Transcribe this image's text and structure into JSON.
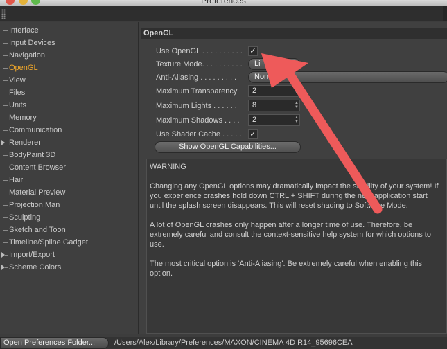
{
  "window": {
    "title": "Preferences"
  },
  "sidebar": {
    "items": [
      {
        "label": "Interface",
        "expandable": false
      },
      {
        "label": "Input Devices",
        "expandable": false
      },
      {
        "label": "Navigation",
        "expandable": false
      },
      {
        "label": "OpenGL",
        "expandable": false,
        "active": true
      },
      {
        "label": "View",
        "expandable": false
      },
      {
        "label": "Files",
        "expandable": false
      },
      {
        "label": "Units",
        "expandable": false
      },
      {
        "label": "Memory",
        "expandable": false
      },
      {
        "label": "Communication",
        "expandable": false
      },
      {
        "label": "Renderer",
        "expandable": true
      },
      {
        "label": "BodyPaint 3D",
        "expandable": false
      },
      {
        "label": "Content Browser",
        "expandable": false
      },
      {
        "label": "Hair",
        "expandable": false
      },
      {
        "label": "Material Preview",
        "expandable": false
      },
      {
        "label": "Projection Man",
        "expandable": false
      },
      {
        "label": "Sculpting",
        "expandable": false
      },
      {
        "label": "Sketch and Toon",
        "expandable": false
      },
      {
        "label": "Timeline/Spline Gadget",
        "expandable": false
      },
      {
        "label": "Import/Export",
        "expandable": true
      },
      {
        "label": "Scheme Colors",
        "expandable": true
      }
    ]
  },
  "main": {
    "section_title": "OpenGL",
    "use_opengl_label": "Use OpenGL . . . . . . . . . .",
    "use_opengl_checked": "✓",
    "texture_mode_label": "Texture Mode. . . . . . . . . .",
    "texture_mode_value": "Li",
    "anti_aliasing_label": "Anti-Aliasing . . . . . . . . .",
    "anti_aliasing_value": "Non",
    "max_transparency_label": "Maximum Transparency",
    "max_transparency_value": "2",
    "max_lights_label": "Maximum Lights . . . . . .",
    "max_lights_value": "8",
    "max_shadows_label": "Maximum Shadows . . . .",
    "max_shadows_value": "2",
    "use_shader_cache_label": "Use Shader Cache . . . . .",
    "use_shader_cache_checked": "✓",
    "capabilities_button": "Show OpenGL Capabilities...",
    "warning": {
      "heading": "WARNING",
      "p1": "Changing any OpenGL options may dramatically impact the stability of your system! If you experience crashes hold down CTRL + SHIFT during the next application start until the splash screen disappears. This will reset shading to Software Mode.",
      "p2": "A lot of OpenGL crashes only happen after a longer time of use. Therefore, be extremely careful and consult the context-sensitive help system for which options to use.",
      "p3": "The most critical option is 'Anti-Aliasing'. Be extremely careful when enabling this option."
    }
  },
  "statusbar": {
    "open_button": "Open Preferences Folder...",
    "path": "/Users/Alex/Library/Preferences/MAXON/CINEMA 4D R14_95696CEA"
  },
  "colors": {
    "active_item": "#f0a72a",
    "annotation_arrow": "#ee5a5a"
  }
}
